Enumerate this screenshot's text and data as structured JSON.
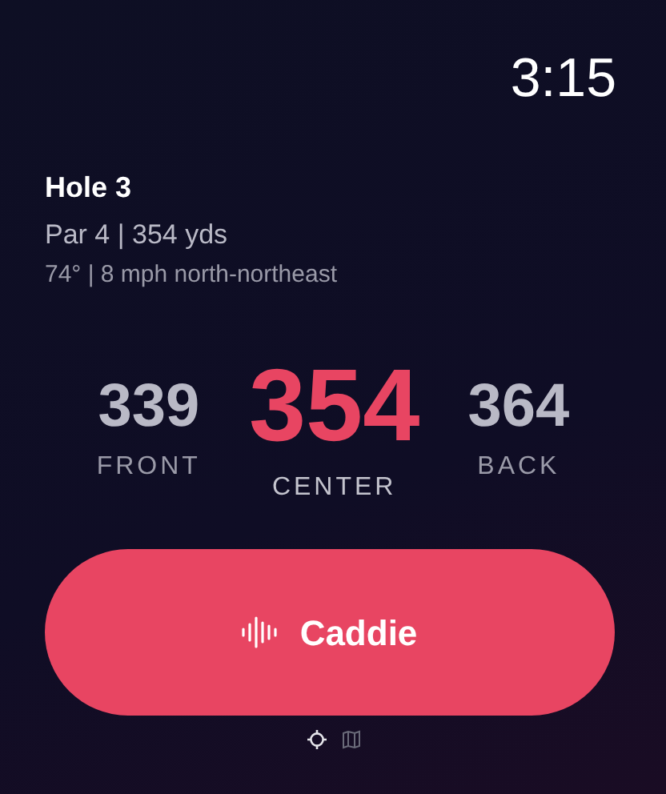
{
  "time": "3:15",
  "hole": {
    "title": "Hole 3",
    "details": "Par 4 | 354 yds",
    "weather": "74° | 8 mph north-northeast"
  },
  "distances": [
    {
      "kind": "side",
      "value": "339",
      "label": "FRONT"
    },
    {
      "kind": "main",
      "value": "354",
      "label": "CENTER"
    },
    {
      "kind": "side",
      "value": "364",
      "label": "BACK"
    }
  ],
  "caddie_button": {
    "label": "Caddie"
  },
  "pages": [
    {
      "kind": "target",
      "selected": true
    },
    {
      "kind": "map",
      "selected": false
    }
  ]
}
